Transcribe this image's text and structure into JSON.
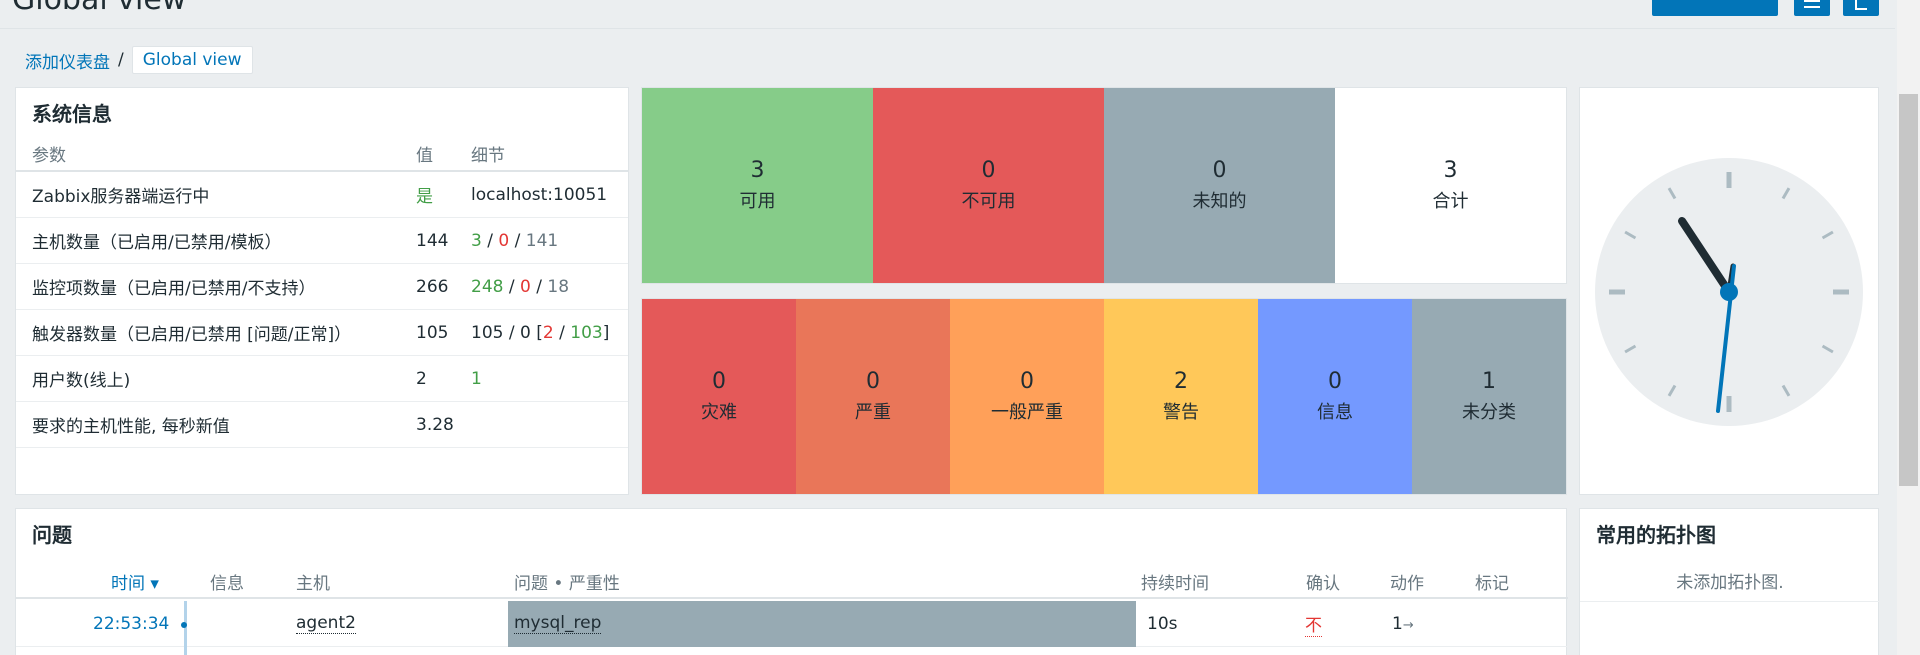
{
  "header": {
    "title": "Global view"
  },
  "breadcrumb": {
    "parent": "添加仪表盘",
    "separator": "/",
    "current": "Global view"
  },
  "system_info": {
    "title": "系统信息",
    "columns": [
      "参数",
      "值",
      "细节"
    ],
    "rows": [
      {
        "param": "Zabbix服务器端运行中",
        "value": "是",
        "detail": "localhost:10051"
      },
      {
        "param": "主机数量（已启用/已禁用/模板）",
        "value": "144",
        "detail_parts": [
          "3",
          "0",
          "141"
        ]
      },
      {
        "param": "监控项数量（已启用/已禁用/不支持）",
        "value": "266",
        "detail_parts": [
          "248",
          "0",
          "18"
        ]
      },
      {
        "param": "触发器数量（已启用/已禁用 [问题/正常]）",
        "value": "105",
        "detail_parts": [
          "105",
          "0",
          "2",
          "103"
        ]
      },
      {
        "param": "用户数(线上)",
        "value": "2",
        "detail": "1"
      },
      {
        "param": "要求的主机性能, 每秒新值",
        "value": "3.28",
        "detail": ""
      }
    ]
  },
  "host_availability": [
    {
      "count": "3",
      "label": "可用",
      "color": "#86cc89"
    },
    {
      "count": "0",
      "label": "不可用",
      "color": "#e45959"
    },
    {
      "count": "0",
      "label": "未知的",
      "color": "#97aab3"
    },
    {
      "count": "3",
      "label": "合计",
      "color": "#ffffff"
    }
  ],
  "severity": [
    {
      "count": "0",
      "label": "灾难",
      "color": "#e45959"
    },
    {
      "count": "0",
      "label": "严重",
      "color": "#e97659"
    },
    {
      "count": "0",
      "label": "一般严重",
      "color": "#ffa059"
    },
    {
      "count": "2",
      "label": "警告",
      "color": "#ffc859"
    },
    {
      "count": "0",
      "label": "信息",
      "color": "#7499ff"
    },
    {
      "count": "1",
      "label": "未分类",
      "color": "#97aab3"
    }
  ],
  "problems": {
    "title": "问题",
    "columns": {
      "time": "时间",
      "info": "信息",
      "host": "主机",
      "problem": "问题 • 严重性",
      "duration": "持续时间",
      "ack": "确认",
      "actions": "动作",
      "tags": "标记"
    },
    "rows": [
      {
        "time": "22:53:34",
        "host": "agent2",
        "problem": "mysql_rep",
        "duration": "10s",
        "ack": "不",
        "actions": "1"
      }
    ]
  },
  "favorite_maps": {
    "title": "常用的拓扑图",
    "empty_text": "未添加拓扑图."
  },
  "colors": {
    "link": "#0275b8",
    "ok": "#429e47",
    "problem": "#e33734"
  }
}
